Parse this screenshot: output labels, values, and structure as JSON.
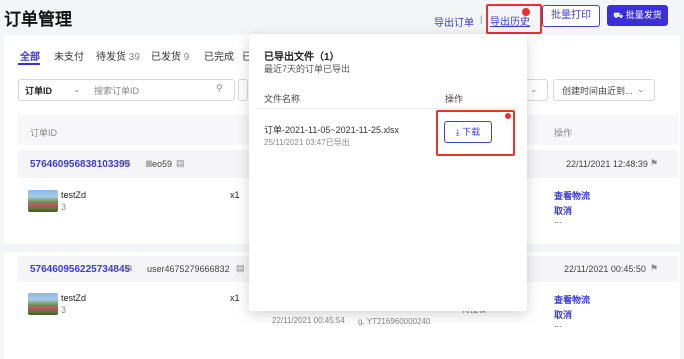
{
  "header": {
    "title": "订单管理",
    "export_orders": "导出订单",
    "export_history": "导出历史",
    "separator": "|",
    "batch_print": "批量打印",
    "batch_ship": "批量发货"
  },
  "tabs": [
    {
      "label": "全部",
      "count": ""
    },
    {
      "label": "未支付",
      "count": ""
    },
    {
      "label": "待发货",
      "count": "39"
    },
    {
      "label": "已发货",
      "count": "9"
    },
    {
      "label": "已完成",
      "count": ""
    },
    {
      "label": "已",
      "count": ""
    }
  ],
  "filters": {
    "order_id_select": "订单ID",
    "search_placeholder": "搜索订单ID",
    "sort_select": "创建时间由近到..."
  },
  "table": {
    "col_order_id": "订单ID",
    "col_action": "操作"
  },
  "orders": [
    {
      "id": "576460956838103395",
      "user": "llleo59",
      "date": "22/11/2021 12:48:39",
      "product": "testZd",
      "variant": "3",
      "qty": "x1",
      "actions": [
        "查看物流",
        "取消",
        "..."
      ]
    },
    {
      "id": "576460956225734845",
      "user": "user4675279666832",
      "date": "22/11/2021 00:45:50",
      "product": "testZd",
      "variant": "3",
      "qty": "x1",
      "created": "22/11/2021 00:45:54",
      "tracking_partial": "g, YT216960000240",
      "status_partial": "待揽收",
      "actions": [
        "查看物流",
        "取消",
        "..."
      ]
    }
  ],
  "popup": {
    "title": "已导出文件（1）",
    "subtitle": "最近7天的订单已导出",
    "col_filename": "文件名称",
    "col_action": "操作",
    "files": [
      {
        "name": "订单-2021-11-05~2021-11-25.xlsx",
        "time": "25/11/2021 03:47已导出",
        "action": "下载"
      }
    ]
  },
  "colors": {
    "accent": "#3b2fdb",
    "highlight": "#e8322e"
  }
}
